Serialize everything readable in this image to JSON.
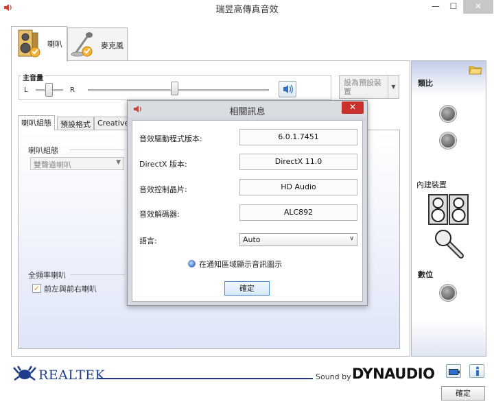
{
  "window": {
    "title": "瑞昱高傳真音效",
    "controls": {
      "minimize": "—",
      "maximize": "☐",
      "close": "✕"
    }
  },
  "device_tabs": [
    {
      "label": "喇叭",
      "active": true
    },
    {
      "label": "麥克風",
      "active": false
    }
  ],
  "volume": {
    "label": "主音量",
    "left": "L",
    "right": "R",
    "balance": 0.5,
    "level": 0.48
  },
  "default_device_button": "設為預設裝置",
  "inner_tabs": [
    "喇叭組態",
    "預設格式",
    "Creative"
  ],
  "speaker_config": {
    "group_label": "喇叭組態",
    "selected": "雙聲道喇叭"
  },
  "full_range": {
    "group_label": "全頻率喇叭",
    "option": "前左與前右喇叭",
    "checked": true
  },
  "side_panel": {
    "analog_out": "類比",
    "internal_device": "內建裝置",
    "digital": "數位"
  },
  "footer": {
    "brand": "REALTEK",
    "sound_by": "Sound by",
    "dynaudio": "DYNAUDIO",
    "ok": "確定"
  },
  "dialog": {
    "title": "相關訊息",
    "close": "✕",
    "rows": [
      {
        "label": "音效驅動程式版本:",
        "value": "6.0.1.7451"
      },
      {
        "label": "DirectX 版本:",
        "value": "DirectX 11.0"
      },
      {
        "label": "音效控制晶片:",
        "value": "HD Audio"
      },
      {
        "label": "音效解碼器:",
        "value": "ALC892"
      }
    ],
    "language_label": "語言:",
    "language_value": "Auto",
    "tray_option": "在通知區域顯示音訊圖示",
    "ok": "確定"
  },
  "colors": {
    "accent_blue": "#1f3c8d",
    "close_red": "#c9312c",
    "check_orange": "#e08a00",
    "panel_gradient": "#dfe5f8"
  },
  "icons": {
    "app": "speaker-icon",
    "folder": "folder-icon",
    "info": "info-icon",
    "battery": "battery-icon"
  }
}
